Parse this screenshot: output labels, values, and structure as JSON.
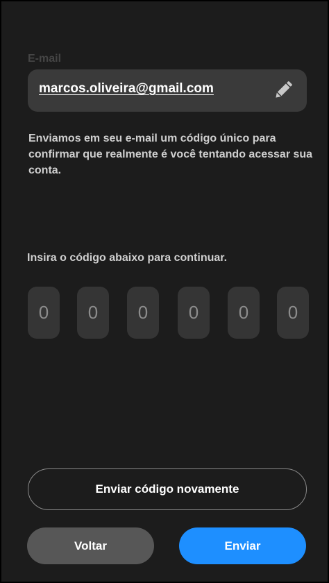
{
  "email_section": {
    "label": "E-mail",
    "value": "marcos.oliveira@gmail.com",
    "edit_icon": "pencil-icon"
  },
  "info_text": "Enviamos em seu e-mail um código único para confirmar que realmente é você tentando acessar sua conta.",
  "code_section": {
    "prompt": "Insira o código abaixo para continuar.",
    "digits": [
      {
        "placeholder": "0"
      },
      {
        "placeholder": "0"
      },
      {
        "placeholder": "0"
      },
      {
        "placeholder": "0"
      },
      {
        "placeholder": "0"
      },
      {
        "placeholder": "0"
      }
    ]
  },
  "actions": {
    "resend_label": "Enviar código novamente",
    "back_label": "Voltar",
    "send_label": "Enviar"
  },
  "colors": {
    "background": "#1c1c1c",
    "field": "#3a3a3a",
    "digit_box": "#353535",
    "primary": "#1e8fff",
    "secondary": "#575757"
  }
}
